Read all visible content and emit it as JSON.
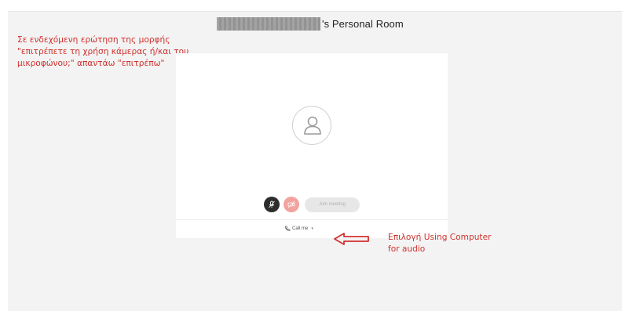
{
  "room": {
    "title_suffix": "'s Personal Room"
  },
  "annotations": {
    "top_left_lines": [
      "Σε ενδεχόμενη ερώτηση της μορφής",
      "\"επιτρέπετε τη χρήση κάμερας ή/και του",
      "μικροφώνου;\" απαντάω \"επιτρέπω\""
    ],
    "bottom_right_lines": [
      "Επιλογή Using Computer",
      "for audio"
    ],
    "color": "#d0312d"
  },
  "controls": {
    "join_label": "Join meeting",
    "call_me_label": "Call me"
  },
  "icons": {
    "avatar": "user-silhouette-icon",
    "mic": "microphone-muted-icon",
    "video": "video-off-icon",
    "phone": "phone-icon",
    "chevron": "chevron-down-icon",
    "arrow": "left-arrow-icon"
  },
  "colors": {
    "mic_button": "#2d2d2d",
    "video_button": "#f2a39f",
    "join_button": "#e7e7e7"
  }
}
